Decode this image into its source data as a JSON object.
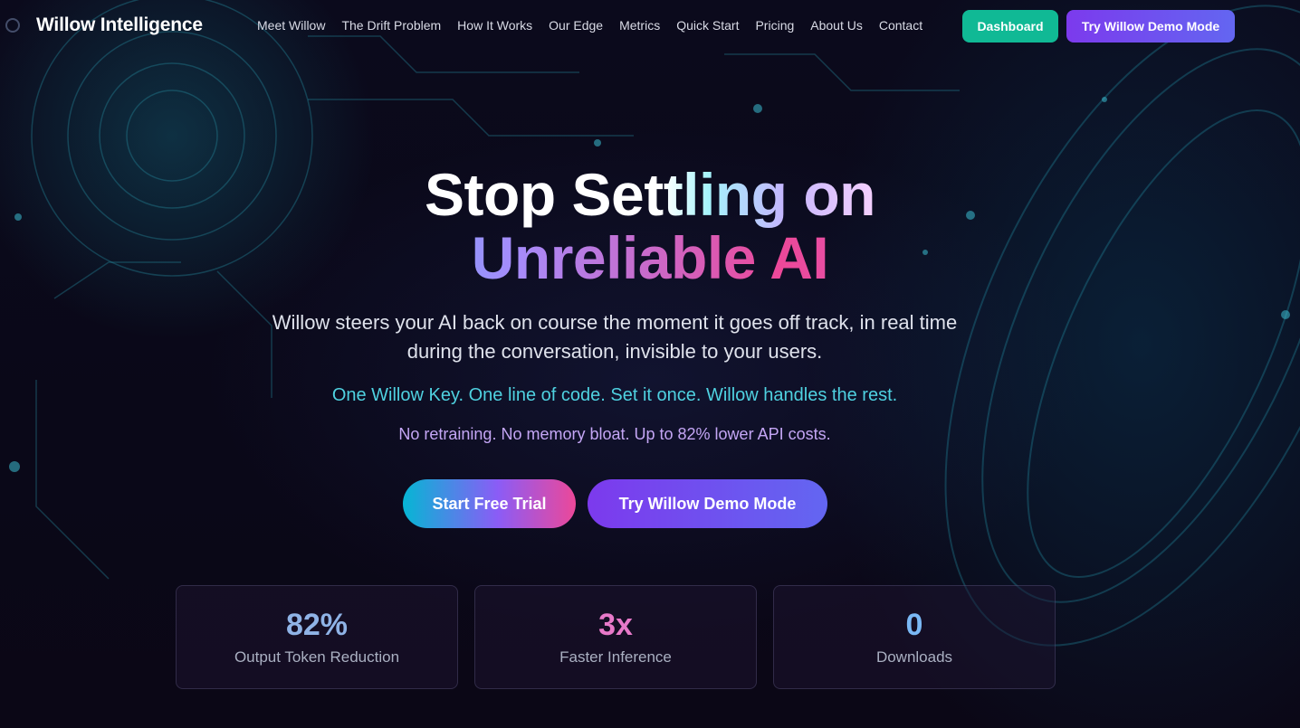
{
  "brand": {
    "name": "Willow Intelligence",
    "icon": "logo-orb-icon"
  },
  "nav": {
    "links": [
      "Meet Willow",
      "The Drift Problem",
      "How It Works",
      "Our Edge",
      "Metrics",
      "Quick Start",
      "Pricing",
      "About Us",
      "Contact"
    ],
    "dashboard_label": "Dashboard",
    "demo_label": "Try Willow Demo Mode"
  },
  "hero": {
    "title_line1_a": "Stop ",
    "title_line1_b": "Settling on",
    "title_line2": "Unreliable AI",
    "subtitle": "Willow steers your AI back on course the moment it goes off track, in real time during the conversation, invisible to your users.",
    "tagline": "One Willow Key. One line of code. Set it once. Willow handles the rest.",
    "benefits": "No retraining. No memory bloat. Up to 82% lower API costs.",
    "cta_primary": "Start Free Trial",
    "cta_secondary": "Try Willow Demo Mode"
  },
  "stats": [
    {
      "value": "82%",
      "label": "Output Token Reduction",
      "color": "#8fb3e6"
    },
    {
      "value": "3x",
      "label": "Faster Inference",
      "color": "#e879c9"
    },
    {
      "value": "0",
      "label": "Downloads",
      "color": "#7ab8f5"
    }
  ],
  "colors": {
    "accent_teal": "#10b995",
    "accent_purple": "#7c3aed",
    "background": "#0a0716"
  }
}
